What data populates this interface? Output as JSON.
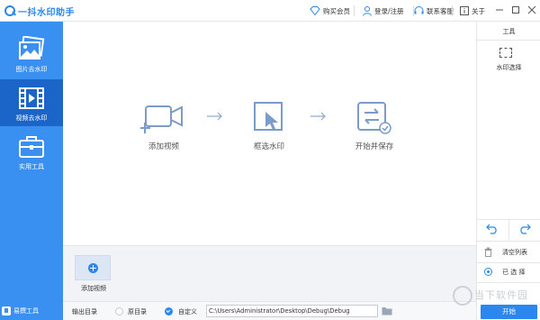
{
  "app": {
    "title": "一抖水印助手"
  },
  "topbar": {
    "buy_label": "购买会员",
    "login_label": "登录/注册",
    "support_label": "联系客服",
    "about_label": "关于"
  },
  "sidebar": {
    "items": [
      {
        "label": "图片去水印",
        "icon": "image-icon"
      },
      {
        "label": "视频去水印",
        "icon": "film-icon"
      },
      {
        "label": "实用工具",
        "icon": "toolbox-icon"
      }
    ],
    "bottom_tool_label": "易撰工具"
  },
  "steps": [
    {
      "label": "添加视频",
      "icon": "add-video-icon"
    },
    {
      "label": "框选水印",
      "icon": "select-watermark-icon"
    },
    {
      "label": "开始并保存",
      "icon": "start-save-icon"
    }
  ],
  "file_panel": {
    "add_label": "添加视频"
  },
  "output": {
    "label": "输出目录",
    "option_original": "原目录",
    "option_custom": "自定义",
    "path": "C:\\Users\\Administrator\\Desktop\\Debug\\Debug"
  },
  "right_panel": {
    "title": "工具",
    "select_label": "水印选择",
    "clear_label": "清空列表",
    "selected_label": "已 选 择",
    "start_label": "开始"
  },
  "watermark": {
    "text": "当下软件园"
  },
  "colors": {
    "accent": "#2b86f0",
    "sidebar": "#3a90f0",
    "sidebar_active": "#1b64c8"
  }
}
